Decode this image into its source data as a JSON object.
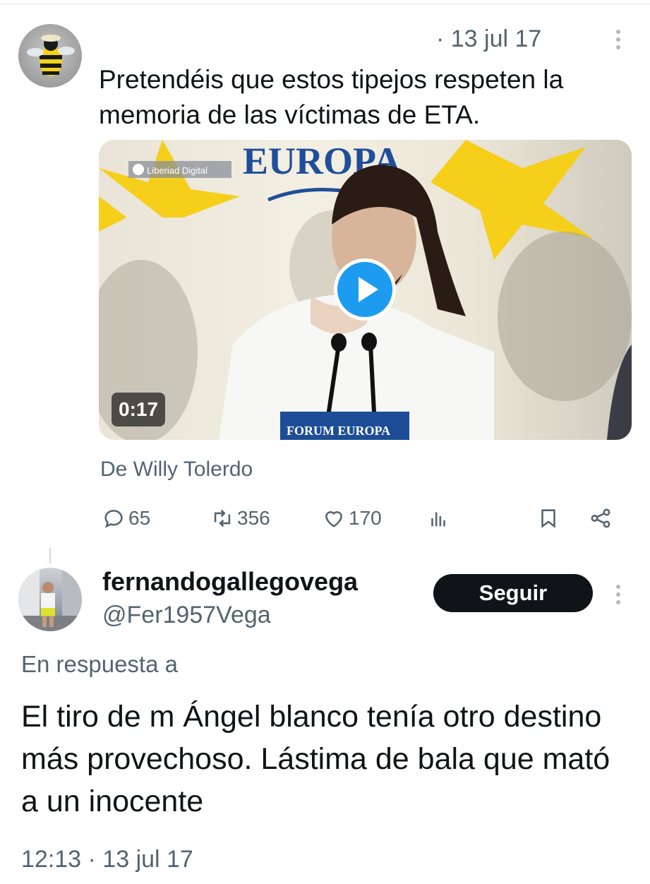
{
  "tweet": {
    "date": "· 13 jul 17",
    "text": "Pretendéis que estos tipejos respeten la memoria de las víctimas de ETA.",
    "media": {
      "watermark": "Liberiad Digital",
      "banner_top": "EUROPA",
      "podium_label": "FORUM EUROPA",
      "duration": "0:17"
    },
    "attribution": "De Willy Tolerdo",
    "actions": {
      "replies": "65",
      "retweets": "356",
      "likes": "170"
    }
  },
  "reply": {
    "display_name": "fernandogallegovega",
    "handle": "@Fer1957Vega",
    "follow_label": "Seguir",
    "reply_to_label": "En respuesta a",
    "text": "El tiro de m Ángel blanco tenía otro destino más provechoso. Lástima de bala que mató a un inocente",
    "timestamp": "12:13 · 13 jul 17"
  },
  "colors": {
    "primary_text": "#0f1419",
    "secondary_text": "#536471",
    "accent": "#1d9bf0",
    "button_dark": "#0f1419"
  },
  "icons": [
    "reply-icon",
    "retweet-icon",
    "like-icon",
    "views-icon",
    "bookmark-icon",
    "share-icon",
    "more-icon",
    "play-icon"
  ]
}
